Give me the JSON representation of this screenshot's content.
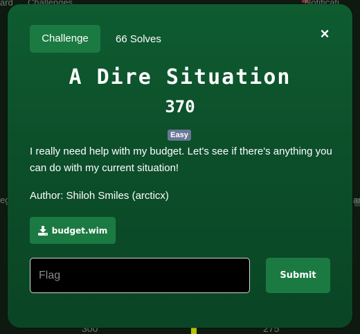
{
  "background": {
    "top_left_text": "ard",
    "top_text": "Challenges",
    "top_right_text": "Notificati",
    "left_text": "eg",
    "right_text": "ar",
    "bottom_left_number": "300",
    "bottom_right_number": "275"
  },
  "modal": {
    "tabs": {
      "challenge_label": "Challenge",
      "solves_label": "66 Solves"
    },
    "close_glyph": "×",
    "title": "A Dire Situation",
    "points": "370",
    "difficulty": "Easy",
    "description": "I really need help with my budget. Let's see if there's anything you can do with my current situation!",
    "author": "Author: Shiloh Smiles (arcticx)",
    "file": {
      "label": "budget.wim",
      "icon": "download-icon"
    },
    "flag_input": {
      "placeholder": "Flag",
      "value": ""
    },
    "submit_label": "Submit"
  },
  "colors": {
    "modal_bg": "#0c4f2a",
    "button_green": "#1b7a42",
    "badge": "#6a7896",
    "text": "#ffffff"
  }
}
